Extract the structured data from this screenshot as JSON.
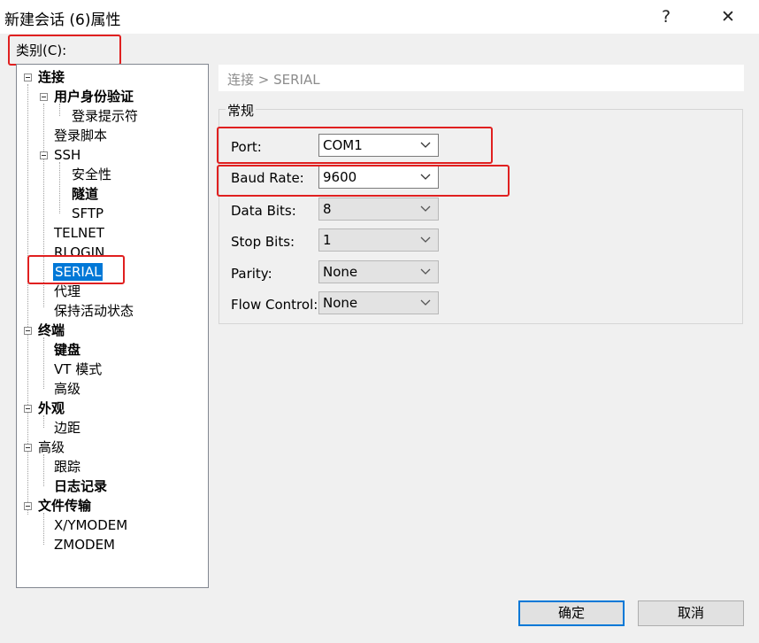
{
  "window": {
    "title": "新建会话 (6)属性",
    "help": "?",
    "close": "✕"
  },
  "category_label": "类别(C):",
  "tree": {
    "connection": "连接",
    "auth": "用户身份验证",
    "login_prompt": "登录提示符",
    "login_script": "登录脚本",
    "ssh": "SSH",
    "security": "安全性",
    "tunnel": "隧道",
    "sftp": "SFTP",
    "telnet": "TELNET",
    "rlogin": "RLOGIN",
    "serial": "SERIAL",
    "proxy": "代理",
    "keepalive": "保持活动状态",
    "terminal": "终端",
    "keyboard": "键盘",
    "vt_mode": "VT 模式",
    "terminal_advanced": "高级",
    "appearance": "外观",
    "margin": "边距",
    "advanced": "高级",
    "trace": "跟踪",
    "logging": "日志记录",
    "file_transfer": "文件传输",
    "xymodem": "X/YMODEM",
    "zmodem": "ZMODEM"
  },
  "breadcrumb": "连接 > SERIAL",
  "group_title": "常规",
  "fields": {
    "port": {
      "label": "Port:",
      "value": "COM1"
    },
    "baud": {
      "label": "Baud Rate:",
      "value": "9600"
    },
    "data_bits": {
      "label": "Data Bits:",
      "value": "8"
    },
    "stop_bits": {
      "label": "Stop Bits:",
      "value": "1"
    },
    "parity": {
      "label": "Parity:",
      "value": "None"
    },
    "flow": {
      "label": "Flow Control:",
      "value": "None"
    }
  },
  "buttons": {
    "ok": "确定",
    "cancel": "取消"
  },
  "colors": {
    "highlight": "#e02020",
    "selection": "#0078d7"
  },
  "icons": [
    "question-icon",
    "close-icon",
    "chevron-down-icon",
    "tree-collapse-icon"
  ]
}
